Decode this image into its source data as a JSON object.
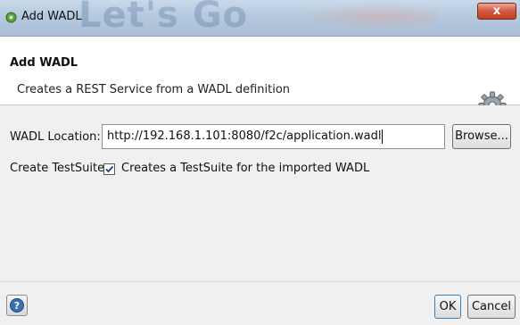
{
  "window": {
    "title": "Add WADL",
    "background_text": "Let's Go",
    "close_label": "x"
  },
  "header": {
    "title": "Add WADL",
    "description": "Creates a REST Service from a WADL definition",
    "icon": "gear-icon"
  },
  "form": {
    "wadl_location_label": "WADL Location:",
    "wadl_location_value": "http://192.168.1.101:8080/f2c/application.wadl",
    "browse_label": "Browse...",
    "create_testsuite_label": "Create TestSuite:",
    "create_testsuite_checked": true,
    "create_testsuite_text": "Creates a TestSuite for the imported WADL"
  },
  "footer": {
    "help_icon": "help-icon",
    "ok_label": "OK",
    "cancel_label": "Cancel"
  },
  "colors": {
    "titlebar": "#b5c9de",
    "close_button": "#d3573e",
    "content_background": "#f0f0f0",
    "help_icon": "#3a6fb0"
  }
}
